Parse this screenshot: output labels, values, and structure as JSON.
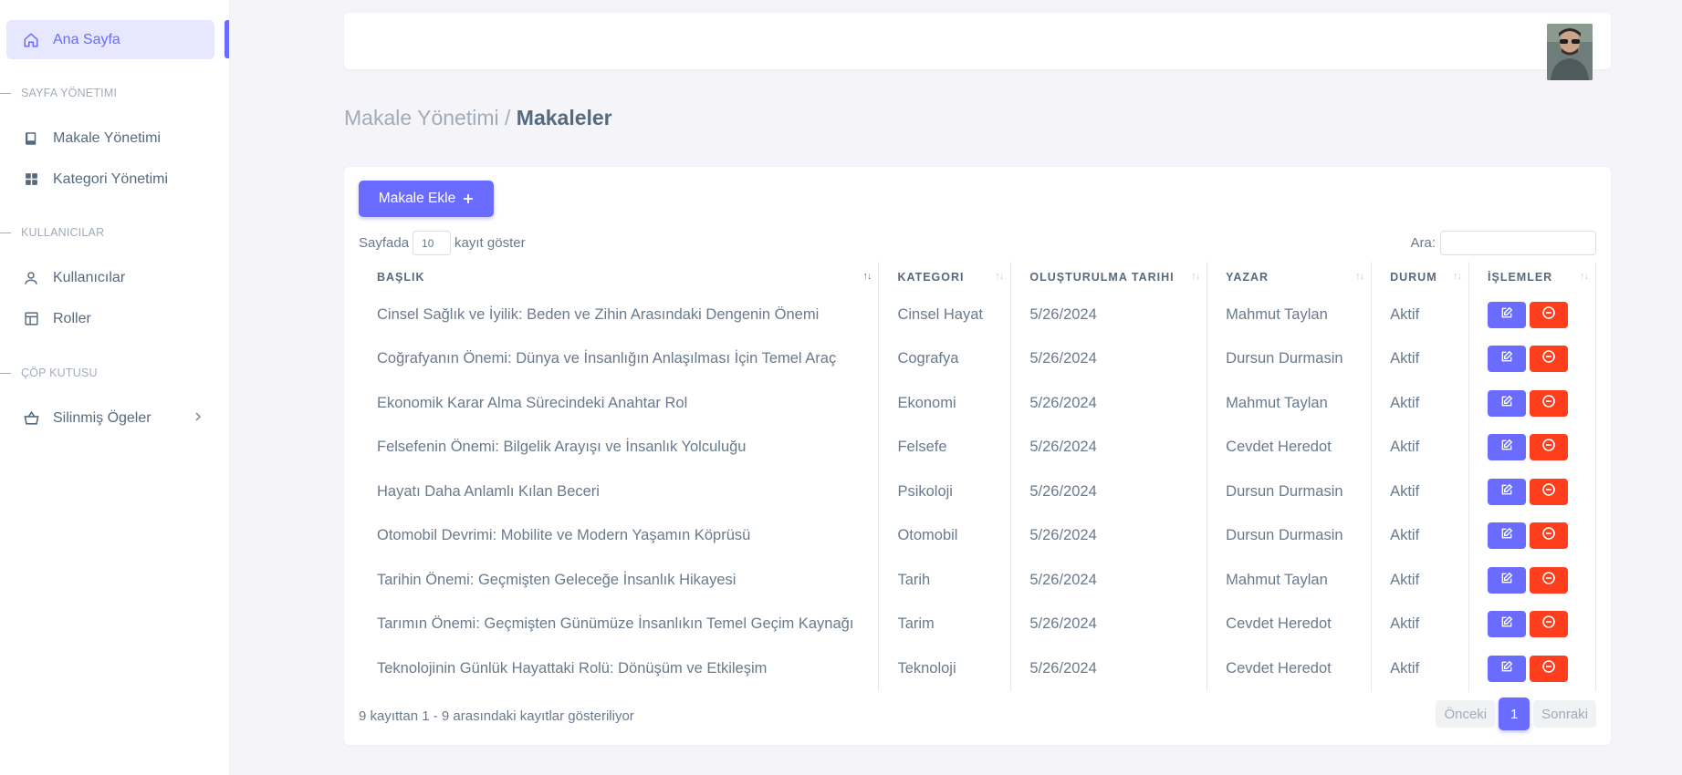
{
  "sidebar": {
    "home_label": "Ana Sayfa",
    "sections": {
      "page_mgmt": "SAYFA YÖNETIMI",
      "users": "KULLANICILAR",
      "trash": "ÇÖP KUTUSU"
    },
    "items": {
      "articles": "Makale Yönetimi",
      "categories": "Kategori Yönetimi",
      "users": "Kullanıcılar",
      "roles": "Roller",
      "deleted": "Silinmiş Ögeler"
    }
  },
  "breadcrumb": {
    "parent": "Makale Yönetimi / ",
    "current": "Makaleler"
  },
  "toolbar": {
    "add_label": "Makale Ekle",
    "add_icon": "plus-icon"
  },
  "length": {
    "prefix": "Sayfada",
    "value": "10",
    "suffix": "kayıt göster"
  },
  "search": {
    "label": "Ara:"
  },
  "table": {
    "headers": [
      "BAŞLIK",
      "KATEGORI",
      "OLUŞTURULMA TARIHI",
      "YAZAR",
      "DURUM",
      "İŞLEMLER"
    ],
    "rows": [
      [
        "Cinsel Sağlık ve İyilik: Beden ve Zihin Arasındaki Dengenin Önemi",
        "Cinsel Hayat",
        "5/26/2024",
        "Mahmut Taylan",
        "Aktif"
      ],
      [
        "Coğrafyanın Önemi: Dünya ve İnsanlığın Anlaşılması İçin Temel Araç",
        "Cografya",
        "5/26/2024",
        "Dursun Durmasin",
        "Aktif"
      ],
      [
        "Ekonomik Karar Alma Sürecindeki Anahtar Rol",
        "Ekonomi",
        "5/26/2024",
        "Mahmut Taylan",
        "Aktif"
      ],
      [
        "Felsefenin Önemi: Bilgelik Arayışı ve İnsanlık Yolculuğu",
        "Felsefe",
        "5/26/2024",
        "Cevdet Heredot",
        "Aktif"
      ],
      [
        "Hayatı Daha Anlamlı Kılan Beceri",
        "Psikoloji",
        "5/26/2024",
        "Dursun Durmasin",
        "Aktif"
      ],
      [
        "Otomobil Devrimi: Mobilite ve Modern Yaşamın Köprüsü",
        "Otomobil",
        "5/26/2024",
        "Dursun Durmasin",
        "Aktif"
      ],
      [
        "Tarihin Önemi: Geçmişten Geleceğe İnsanlık Hikayesi",
        "Tarih",
        "5/26/2024",
        "Mahmut Taylan",
        "Aktif"
      ],
      [
        "Tarımın Önemi: Geçmişten Günümüze İnsanlıkın Temel Geçim Kaynağı",
        "Tarim",
        "5/26/2024",
        "Cevdet Heredot",
        "Aktif"
      ],
      [
        "Teknolojinin Günlük Hayattaki Rolü: Dönüşüm ve Etkileşim",
        "Teknoloji",
        "5/26/2024",
        "Cevdet Heredot",
        "Aktif"
      ]
    ]
  },
  "footer": {
    "info": "9 kayıttan 1 - 9 arasındaki kayıtlar gösteriliyor",
    "prev": "Önceki",
    "page": "1",
    "next": "Sonraki"
  },
  "colors": {
    "primary": "#696cff",
    "danger": "#ff3e1d",
    "active_bg": "#e7e7ff"
  }
}
